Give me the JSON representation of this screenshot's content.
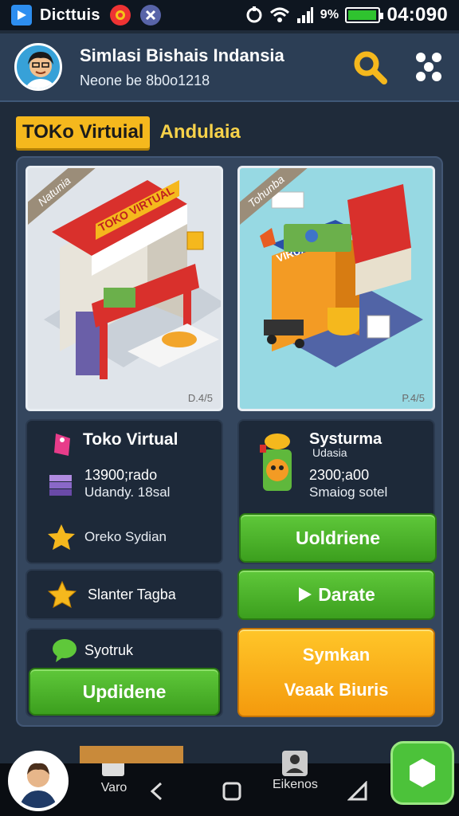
{
  "status_bar": {
    "app_name": "Dicttuis",
    "battery_percent_label": "9%",
    "time": "04:090",
    "battery_level": 0.95
  },
  "header": {
    "title": "Simlasi Bishais Indansia",
    "subtitle": "Neone be 8b0o1218"
  },
  "section": {
    "tag": "TOKo Virtuial",
    "subtitle": "Andulaia"
  },
  "cards": [
    {
      "ribbon": "Natunia",
      "sign_text": "TOKO VIRTUAL",
      "corner_price": "D.4/5",
      "name": "Toko Virtual",
      "price": "13900;rado",
      "detail": "Udandy. 18sal",
      "feature": "Oreko Sydian"
    },
    {
      "ribbon": "Tohunba",
      "sign_text": "VIRUAL",
      "corner_price": "P.4/5",
      "name": "Systurma",
      "tagline": "Udasia",
      "price": "2300;a00",
      "detail": "Smaiog sotel",
      "action": "Uoldriene"
    }
  ],
  "rows": {
    "left_row": "Slanter Tagba",
    "right_row_button": "Darate",
    "left_card_label": "Syotruk",
    "left_card_button": "Updidene",
    "right_orange_line1": "Symkan",
    "right_orange_line2": "Veaak Biuris"
  },
  "bottom_nav": {
    "item1": "Varo",
    "item2": "Eikenos"
  },
  "colors": {
    "accent_yellow": "#f5b81d",
    "button_green": "#4cb52a",
    "button_orange": "#f7a818",
    "panel": "#34465e",
    "header": "#2c3e55"
  }
}
